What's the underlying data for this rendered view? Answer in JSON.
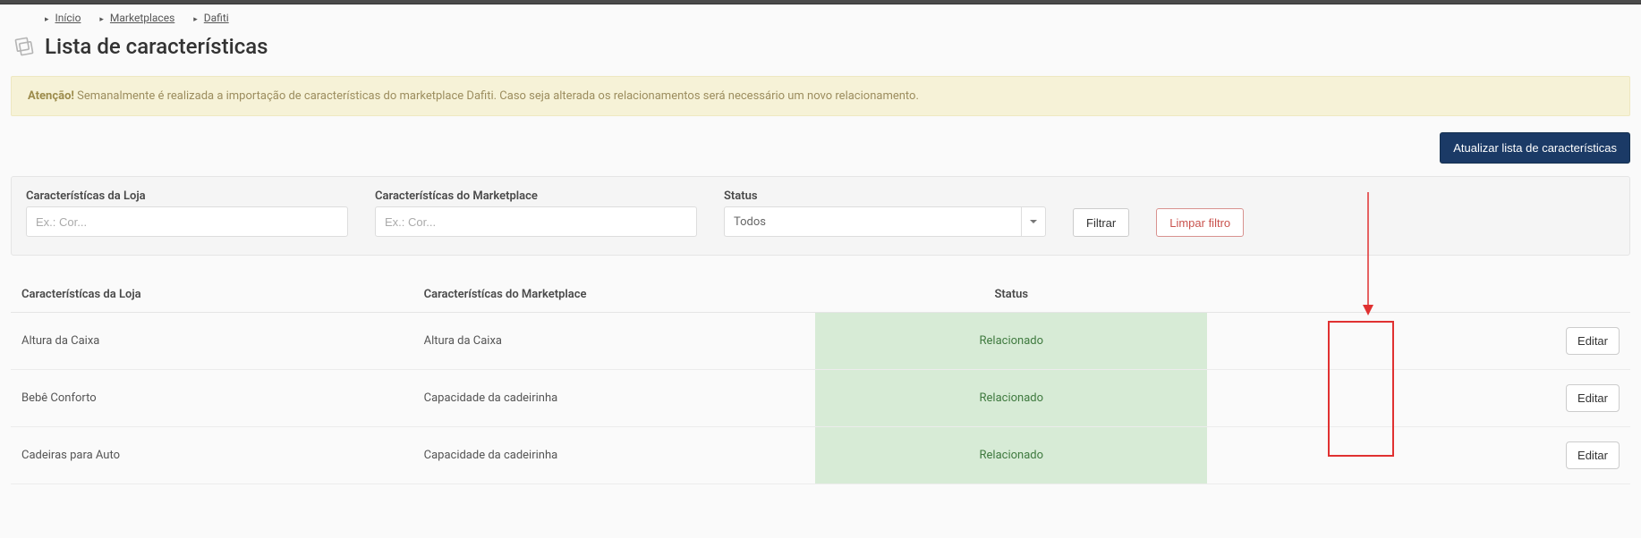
{
  "breadcrumbs": [
    {
      "label": "Início"
    },
    {
      "label": "Marketplaces"
    },
    {
      "label": "Dafiti"
    }
  ],
  "page": {
    "title": "Lista de características"
  },
  "alert": {
    "strong": "Atenção!",
    "text": " Semanalmente é realizada a importação de características do marketplace Dafiti. Caso seja alterada os relacionamentos será necessário um novo relacionamento."
  },
  "buttons": {
    "update_list": "Atualizar lista de características",
    "filter": "Filtrar",
    "clear_filter": "Limpar filtro",
    "edit": "Editar"
  },
  "filters": {
    "store_char_label": "Característícas da Loja",
    "store_char_placeholder": "Ex.: Cor...",
    "market_char_label": "Característícas do Marketplace",
    "market_char_placeholder": "Ex.: Cor...",
    "status_label": "Status",
    "status_selected": "Todos"
  },
  "table": {
    "headers": {
      "store": "Característícas da Loja",
      "marketplace": "Característícas do Marketplace",
      "status": "Status"
    },
    "rows": [
      {
        "store": "Altura da Caixa",
        "marketplace": "Altura da Caixa",
        "status": "Relacionado"
      },
      {
        "store": "Bebê Conforto",
        "marketplace": "Capacidade da cadeirinha",
        "status": "Relacionado"
      },
      {
        "store": "Cadeiras para Auto",
        "marketplace": "Capacidade da cadeirinha",
        "status": "Relacionado"
      }
    ]
  }
}
